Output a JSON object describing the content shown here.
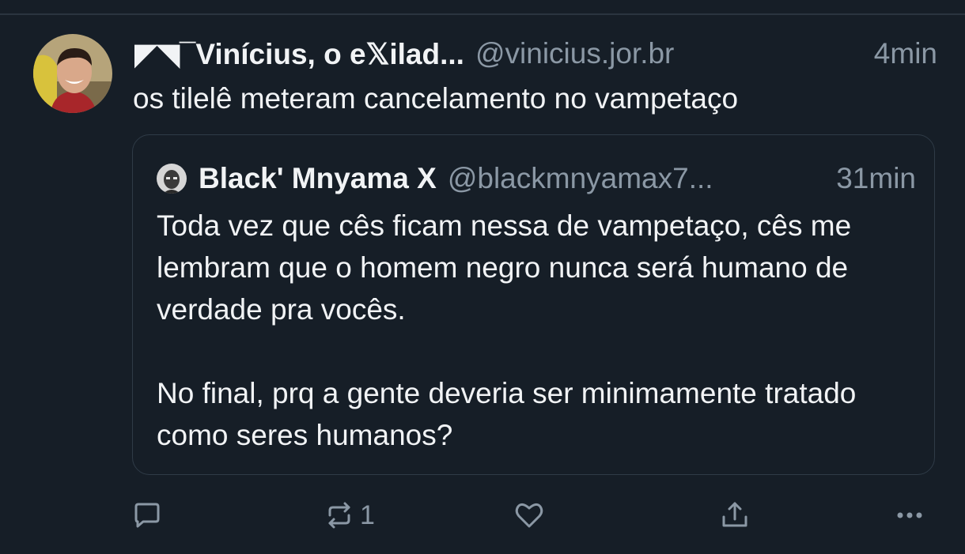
{
  "post": {
    "author_name": "◤◥¯Vinícius, o e𝕏ilad...",
    "handle": "@vinicius.jor.br",
    "time": "4min",
    "text": "os tilelê meteram cancelamento no vampetaço"
  },
  "quote": {
    "author_name": "Black' Mnyama X",
    "handle": "@blackmnyamax7...",
    "time": "31min",
    "paragraphs": [
      "Toda vez que cês ficam nessa de vampetaço, cês me lembram que o homem negro nunca será humano de verdade pra vocês.",
      "No final, prq a gente deveria ser minimamente tratado como seres humanos?"
    ]
  },
  "actions": {
    "reply_icon": "speech-bubble-icon",
    "repost_icon": "repost-icon",
    "repost_count": "1",
    "like_icon": "heart-icon",
    "share_icon": "share-icon",
    "more_icon": "more-dots-icon"
  },
  "colors": {
    "background": "#161e27",
    "text": "#f1f3f5",
    "muted": "#8b98a5",
    "border": "#2f3b47"
  }
}
